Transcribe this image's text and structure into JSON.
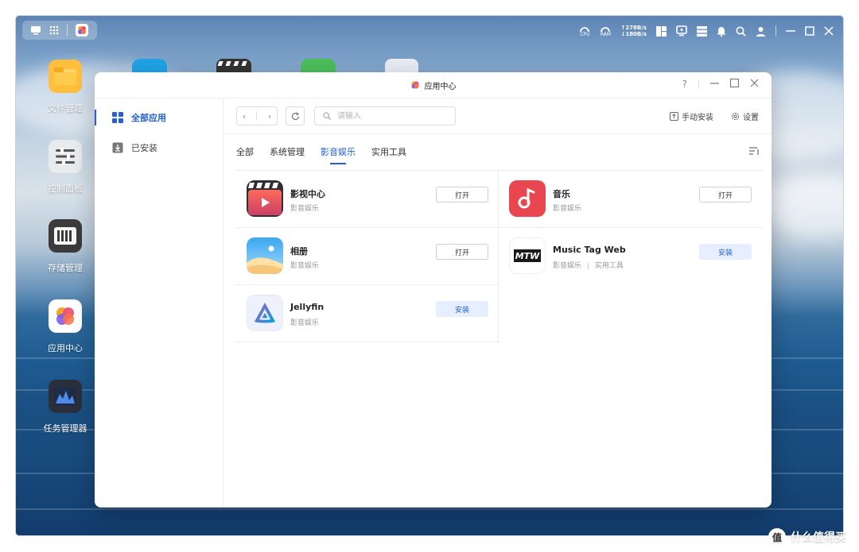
{
  "topbar": {
    "net_up": "↑278B/s",
    "net_down": "↓180B/s",
    "cpu_label": "CPU",
    "ram_label": "RAM"
  },
  "desktop": {
    "icons": [
      {
        "label": "文件管理",
        "icon": "folder-icon"
      },
      {
        "label": "控制面板",
        "icon": "control-panel-icon"
      },
      {
        "label": "存储管理",
        "icon": "storage-icon"
      },
      {
        "label": "应用中心",
        "icon": "app-center-icon"
      },
      {
        "label": "任务管理器",
        "icon": "task-manager-icon"
      }
    ]
  },
  "window": {
    "title": "应用中心",
    "help": "?",
    "sidebar": [
      {
        "label": "全部应用",
        "active": true
      },
      {
        "label": "已安装",
        "active": false
      }
    ],
    "search_placeholder": "请输入",
    "manual_install": "手动安装",
    "settings": "设置",
    "tabs": [
      {
        "label": "全部",
        "active": false
      },
      {
        "label": "系统管理",
        "active": false
      },
      {
        "label": "影音娱乐",
        "active": true
      },
      {
        "label": "实用工具",
        "active": false
      }
    ],
    "apps": [
      {
        "name": "影视中心",
        "category": "影音娱乐",
        "action": "打开"
      },
      {
        "name": "音乐",
        "category": "影音娱乐",
        "action": "打开"
      },
      {
        "name": "相册",
        "category": "影音娱乐",
        "action": "打开"
      },
      {
        "name": "Music Tag Web",
        "category": "影音娱乐",
        "category2": "实用工具",
        "action": "安装"
      },
      {
        "name": "Jellyfin",
        "category": "影音娱乐",
        "action": "安装"
      }
    ]
  },
  "watermark": "什么值得买",
  "colors": {
    "accent": "#2460d8",
    "install_bg": "#e6efff"
  }
}
